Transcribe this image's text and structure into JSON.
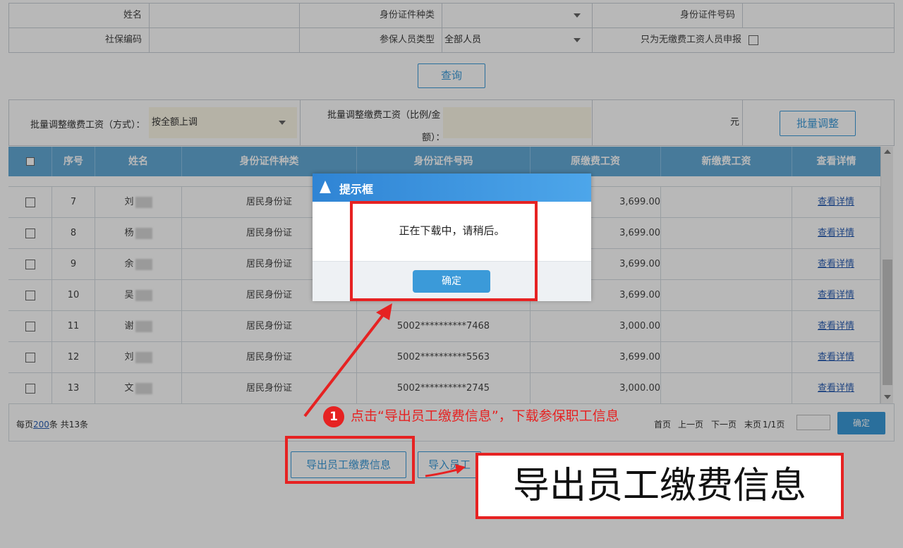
{
  "form": {
    "name_label": "姓名",
    "id_type_label": "身份证件种类",
    "id_number_label": "身份证件号码",
    "social_code_label": "社保编码",
    "insured_type_label": "参保人员类型",
    "insured_type_value": "全部人员",
    "only_no_wage_label": "只为无缴费工资人员申报"
  },
  "query_button": "查询",
  "batch": {
    "mode_label": "批量调整缴费工资（方式）：",
    "mode_value": "按全额上调",
    "ratio_label_1": "批量调整缴费工资（比例/金",
    "ratio_label_2": "额）：",
    "unit": "元",
    "adjust_button": "批量调整"
  },
  "table": {
    "headers": [
      "序号",
      "姓名",
      "身份证件种类",
      "身份证件号码",
      "原缴费工资",
      "新缴费工资",
      "查看详情"
    ],
    "rows": [
      {
        "no": "7",
        "name": "刘",
        "id_type": "居民身份证",
        "id_number": "",
        "old_wage": "3,699.00",
        "detail": "查看详情"
      },
      {
        "no": "8",
        "name": "杨",
        "id_type": "居民身份证",
        "id_number": "",
        "old_wage": "3,699.00",
        "detail": "查看详情"
      },
      {
        "no": "9",
        "name": "余",
        "id_type": "居民身份证",
        "id_number": "",
        "old_wage": "3,699.00",
        "detail": "查看详情"
      },
      {
        "no": "10",
        "name": "吴",
        "id_type": "居民身份证",
        "id_number": "",
        "old_wage": "3,699.00",
        "detail": "查看详情"
      },
      {
        "no": "11",
        "name": "谢",
        "id_type": "居民身份证",
        "id_number": "5002**********7468",
        "old_wage": "3,000.00",
        "detail": "查看详情"
      },
      {
        "no": "12",
        "name": "刘",
        "id_type": "居民身份证",
        "id_number": "5002**********5563",
        "old_wage": "3,699.00",
        "detail": "查看详情"
      },
      {
        "no": "13",
        "name": "文",
        "id_type": "居民身份证",
        "id_number": "5002**********2745",
        "old_wage": "3,000.00",
        "detail": "查看详情"
      }
    ]
  },
  "pager": {
    "per_page_prefix": "每页",
    "per_page_value": "200",
    "per_page_suffix": "条 共13条",
    "first": "首页",
    "prev": "上一页",
    "next": "下一页",
    "last": "末页",
    "page_info": "1/1页",
    "confirm": "确定"
  },
  "bottom_buttons": {
    "export": "导出员工缴费信息",
    "import": "导入员工"
  },
  "dialog": {
    "title": "提示框",
    "message": "正在下载中，请稍后。",
    "ok": "确定"
  },
  "annotation": {
    "step_number": "1",
    "step_text": "点击“导出员工缴费信息”，下载参保职工信息",
    "big_label": "导出员工缴费信息"
  },
  "colors": {
    "accent": "#3b9ad9",
    "header": "#63a9d6",
    "annotation_red": "#e62222"
  }
}
